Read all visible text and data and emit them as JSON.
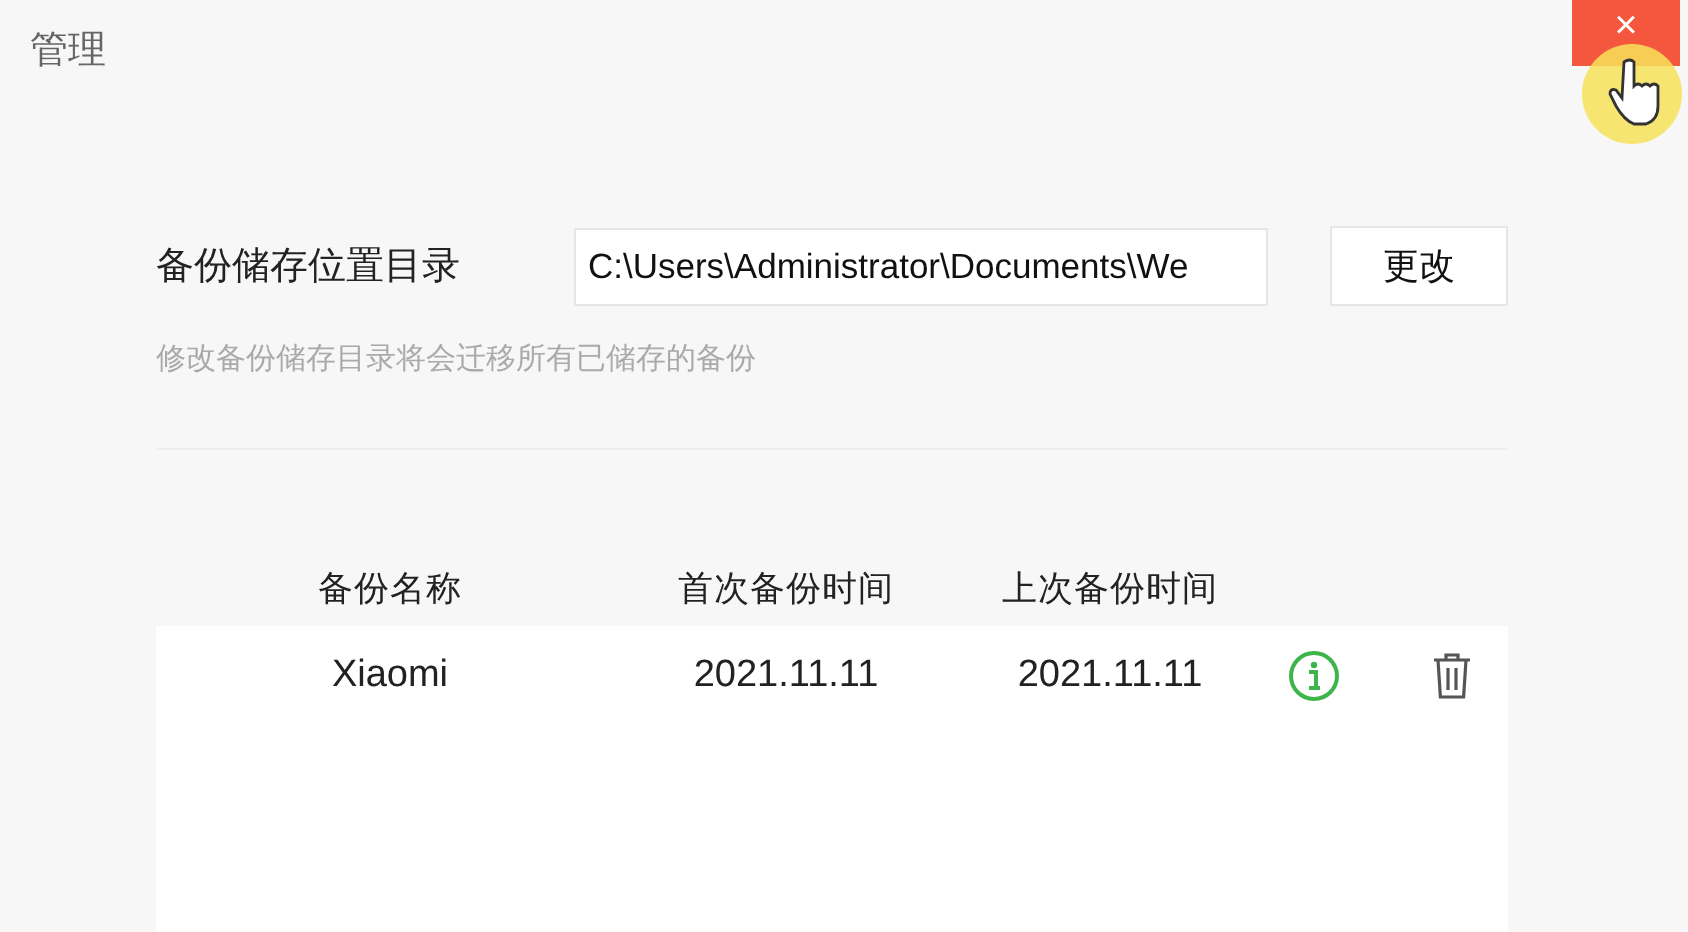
{
  "window": {
    "title": "管理",
    "close": "×"
  },
  "backup_location": {
    "label": "备份储存位置目录",
    "value": "C:\\Users\\Administrator\\Documents\\We",
    "button": "更改",
    "hint": "修改备份储存目录将会迁移所有已储存的备份"
  },
  "table": {
    "columns": [
      "备份名称",
      "首次备份时间",
      "上次备份时间"
    ],
    "rows": [
      {
        "name": "Xiaomi",
        "first_backup": "2021.11.11",
        "last_backup": "2021.11.11"
      }
    ]
  }
}
